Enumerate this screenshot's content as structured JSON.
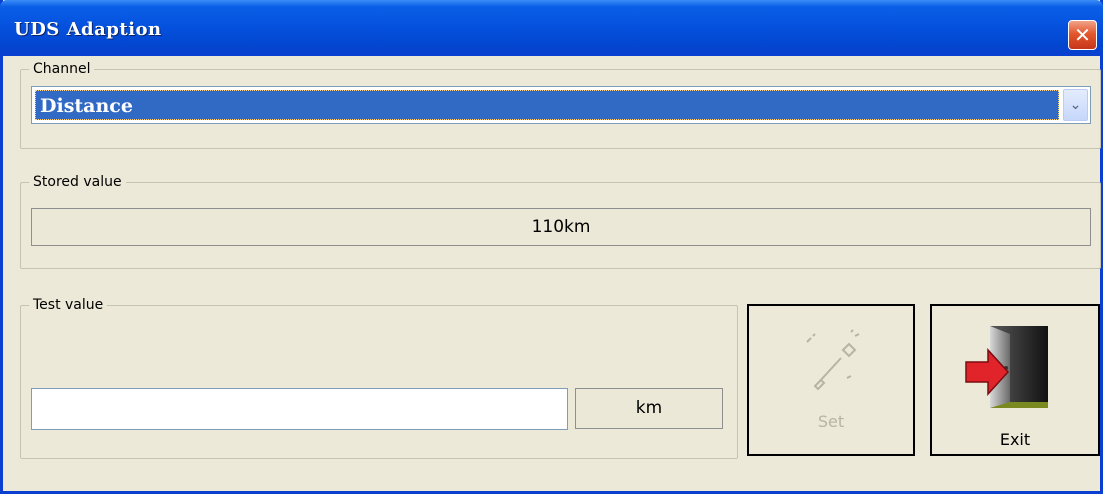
{
  "window": {
    "title": "UDS Adaption",
    "close_label": "✕"
  },
  "channel": {
    "legend": "Channel",
    "selected": "Distance"
  },
  "stored": {
    "legend": "Stored value",
    "value": "110km"
  },
  "test": {
    "legend": "Test value",
    "input_value": "",
    "unit": "km"
  },
  "buttons": {
    "set_label": "Set",
    "exit_label": "Exit"
  }
}
